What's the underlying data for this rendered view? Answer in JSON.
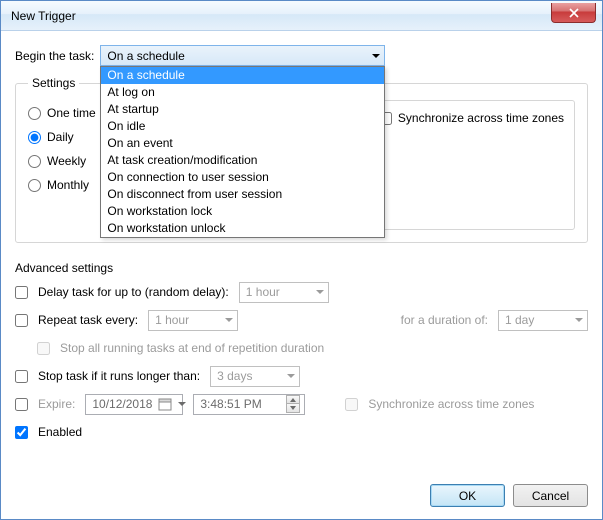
{
  "window": {
    "title": "New Trigger"
  },
  "begin": {
    "label": "Begin the task:",
    "selected": "On a schedule",
    "options": [
      "On a schedule",
      "At log on",
      "At startup",
      "On idle",
      "On an event",
      "At task creation/modification",
      "On connection to user session",
      "On disconnect from user session",
      "On workstation lock",
      "On workstation unlock"
    ]
  },
  "settings": {
    "legend": "Settings",
    "radios": {
      "one_time": "One time",
      "daily": "Daily",
      "weekly": "Weekly",
      "monthly": "Monthly",
      "selected": "daily"
    },
    "sync_label": "Synchronize across time zones"
  },
  "advanced": {
    "heading": "Advanced settings",
    "delay": {
      "label": "Delay task for up to (random delay):",
      "value": "1 hour"
    },
    "repeat": {
      "label": "Repeat task every:",
      "value": "1 hour",
      "duration_label": "for a duration of:",
      "duration_value": "1 day",
      "stop_label": "Stop all running tasks at end of repetition duration"
    },
    "stop_if": {
      "label": "Stop task if it runs longer than:",
      "value": "3 days"
    },
    "expire": {
      "label": "Expire:",
      "date": "10/12/2018",
      "time": "3:48:51 PM",
      "sync_label": "Synchronize across time zones"
    },
    "enabled_label": "Enabled"
  },
  "buttons": {
    "ok": "OK",
    "cancel": "Cancel"
  }
}
